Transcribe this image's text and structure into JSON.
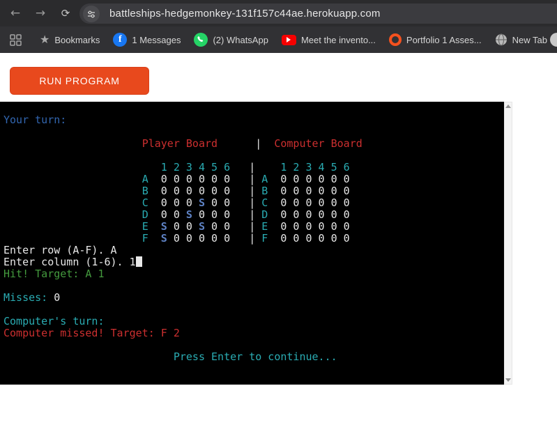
{
  "browser": {
    "url": "battleships-hedgemonkey-131f157c44ae.herokuapp.com",
    "bookmarks_label": "Bookmarks",
    "bookmarks": [
      {
        "icon": "facebook-icon",
        "label": "1 Messages"
      },
      {
        "icon": "whatsapp-icon",
        "label": "(2) WhatsApp"
      },
      {
        "icon": "youtube-icon",
        "label": "Meet the invento..."
      },
      {
        "icon": "portfolio-icon",
        "label": "Portfolio 1 Asses..."
      },
      {
        "icon": "globe-icon",
        "label": "New Tab"
      }
    ]
  },
  "page": {
    "run_button_label": "RUN PROGRAM",
    "accent_color": "#e8491d"
  },
  "game": {
    "boards": {
      "player": {
        "columns": [
          "1",
          "2",
          "3",
          "4",
          "5",
          "6"
        ],
        "rows": [
          "A",
          "B",
          "C",
          "D",
          "E",
          "F"
        ],
        "cells": [
          [
            "0",
            "0",
            "0",
            "0",
            "0",
            "0"
          ],
          [
            "0",
            "0",
            "0",
            "0",
            "0",
            "0"
          ],
          [
            "0",
            "0",
            "0",
            "S",
            "0",
            "0"
          ],
          [
            "0",
            "0",
            "S",
            "0",
            "0",
            "0"
          ],
          [
            "S",
            "0",
            "0",
            "S",
            "0",
            "0"
          ],
          [
            "S",
            "0",
            "0",
            "0",
            "0",
            "0"
          ]
        ]
      },
      "computer": {
        "columns": [
          "1",
          "2",
          "3",
          "4",
          "5",
          "6"
        ],
        "rows": [
          "A",
          "B",
          "C",
          "D",
          "E",
          "F"
        ],
        "cells": [
          [
            "0",
            "0",
            "0",
            "0",
            "0",
            "0"
          ],
          [
            "0",
            "0",
            "0",
            "0",
            "0",
            "0"
          ],
          [
            "0",
            "0",
            "0",
            "0",
            "0",
            "0"
          ],
          [
            "0",
            "0",
            "0",
            "0",
            "0",
            "0"
          ],
          [
            "0",
            "0",
            "0",
            "0",
            "0",
            "0"
          ],
          [
            "0",
            "0",
            "0",
            "0",
            "0",
            "0"
          ]
        ]
      }
    },
    "misses": "0",
    "player_target": "A 1",
    "computer_target": "F 2"
  },
  "terminal": {
    "palette": {
      "background": "#000000",
      "foreground": "#e8e8e8",
      "blue": "#3266b0",
      "bright_blue": "#5e82c4",
      "cyan": "#2aacb3",
      "red": "#cc2f2f",
      "green": "#449a3e"
    },
    "lines": [
      [],
      [
        [
          "Your turn:",
          "blue"
        ]
      ],
      [],
      [
        [
          "                      ",
          "fg"
        ],
        [
          "Player Board",
          "red"
        ],
        [
          "      ",
          "fg"
        ],
        [
          "|",
          "fg"
        ],
        [
          "  ",
          "fg"
        ],
        [
          "Computer Board",
          "red"
        ]
      ],
      [],
      [
        [
          "                         ",
          "fg"
        ],
        [
          "1 2 3 4 5 6",
          "cyan"
        ],
        [
          "   |    ",
          "fg"
        ],
        [
          "1 2 3 4 5 6",
          "cyan"
        ]
      ],
      [
        [
          "                      ",
          "fg"
        ],
        [
          "A",
          "cyan"
        ],
        [
          "  ",
          "fg"
        ],
        [
          "0 0 0 0 0 0",
          "fg"
        ],
        [
          "   | ",
          "fg"
        ],
        [
          "A",
          "cyan"
        ],
        [
          "  ",
          "fg"
        ],
        [
          "0 0 0 0 0 0",
          "fg"
        ]
      ],
      [
        [
          "                      ",
          "fg"
        ],
        [
          "B",
          "cyan"
        ],
        [
          "  ",
          "fg"
        ],
        [
          "0 0 0 0 0 0",
          "fg"
        ],
        [
          "   | ",
          "fg"
        ],
        [
          "B",
          "cyan"
        ],
        [
          "  ",
          "fg"
        ],
        [
          "0 0 0 0 0 0",
          "fg"
        ]
      ],
      [
        [
          "                      ",
          "fg"
        ],
        [
          "C",
          "cyan"
        ],
        [
          "  ",
          "fg"
        ],
        [
          "0 0 0 ",
          "fg"
        ],
        [
          "S",
          "bblue"
        ],
        [
          " 0 0",
          "fg"
        ],
        [
          "   | ",
          "fg"
        ],
        [
          "C",
          "cyan"
        ],
        [
          "  ",
          "fg"
        ],
        [
          "0 0 0 0 0 0",
          "fg"
        ]
      ],
      [
        [
          "                      ",
          "fg"
        ],
        [
          "D",
          "cyan"
        ],
        [
          "  ",
          "fg"
        ],
        [
          "0 0 ",
          "fg"
        ],
        [
          "S",
          "bblue"
        ],
        [
          " 0 0 0",
          "fg"
        ],
        [
          "   | ",
          "fg"
        ],
        [
          "D",
          "cyan"
        ],
        [
          "  ",
          "fg"
        ],
        [
          "0 0 0 0 0 0",
          "fg"
        ]
      ],
      [
        [
          "                      ",
          "fg"
        ],
        [
          "E",
          "cyan"
        ],
        [
          "  ",
          "fg"
        ],
        [
          "S",
          "bblue"
        ],
        [
          " 0 0 ",
          "fg"
        ],
        [
          "S",
          "bblue"
        ],
        [
          " 0 0",
          "fg"
        ],
        [
          "   | ",
          "fg"
        ],
        [
          "E",
          "cyan"
        ],
        [
          "  ",
          "fg"
        ],
        [
          "0 0 0 0 0 0",
          "fg"
        ]
      ],
      [
        [
          "                      ",
          "fg"
        ],
        [
          "F",
          "cyan"
        ],
        [
          "  ",
          "fg"
        ],
        [
          "S",
          "bblue"
        ],
        [
          " 0 0 0 0 0",
          "fg"
        ],
        [
          "   | ",
          "fg"
        ],
        [
          "F",
          "cyan"
        ],
        [
          "  ",
          "fg"
        ],
        [
          "0 0 0 0 0 0",
          "fg"
        ]
      ],
      [
        [
          "Enter row (A-F). A",
          "fg"
        ]
      ],
      [
        [
          "Enter column (1-6). 1",
          "fg"
        ],
        [
          "",
          "cursor"
        ]
      ],
      [
        [
          "Hit! Target: A 1",
          "green"
        ]
      ],
      [],
      [
        [
          "Misses:",
          "cyan"
        ],
        [
          " 0",
          "fg"
        ]
      ],
      [],
      [
        [
          "Computer's turn:",
          "cyan"
        ]
      ],
      [
        [
          "Computer missed! Target: F 2",
          "red"
        ]
      ],
      [],
      [
        [
          "                           ",
          "fg"
        ],
        [
          "Press Enter to continue...",
          "cyan"
        ]
      ]
    ]
  }
}
